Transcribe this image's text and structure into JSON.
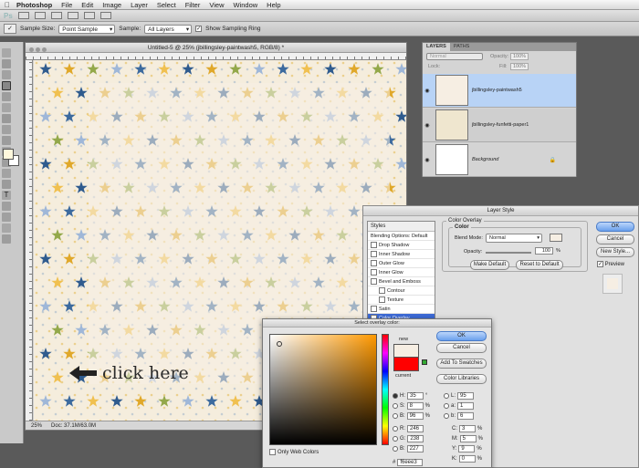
{
  "menubar": {
    "app": "Photoshop",
    "items": [
      "File",
      "Edit",
      "Image",
      "Layer",
      "Select",
      "Filter",
      "View",
      "Window",
      "Help"
    ]
  },
  "appbar": {
    "logo": "Ps"
  },
  "options": {
    "sample_size_label": "Sample Size:",
    "sample_size_value": "Point Sample",
    "sample_label": "Sample:",
    "sample_value": "All Layers",
    "show_ring_label": "Show Sampling Ring"
  },
  "document": {
    "title": "Untitled-5 @ 25% (jbillingsley-paintwash5, RGB/8) *",
    "zoom": "25%",
    "doc_info": "Doc: 37.1M/63.0M"
  },
  "annotation": {
    "text": "click here"
  },
  "layers_panel": {
    "tabs": [
      "LAYERS",
      "PATHS"
    ],
    "blend_value": "Normal",
    "opacity_label": "Opacity:",
    "opacity_value": "100%",
    "lock_label": "Lock:",
    "fill_label": "Fill:",
    "fill_value": "100%",
    "layers": [
      {
        "name": "jbillingsley-paintwash5",
        "selected": true
      },
      {
        "name": "jbillingsley-funfetti-paper1",
        "selected": false
      },
      {
        "name": "Background",
        "selected": false
      }
    ]
  },
  "layer_style": {
    "title": "Layer Style",
    "styles_header": "Styles",
    "blending_options": "Blending Options: Default",
    "items": [
      "Drop Shadow",
      "Inner Shadow",
      "Outer Glow",
      "Inner Glow",
      "Bevel and Emboss",
      "Contour",
      "Texture",
      "Satin",
      "Color Overlay"
    ],
    "section_title": "Color Overlay",
    "sub_title": "Color",
    "blend_mode_label": "Blend Mode:",
    "blend_mode_value": "Normal",
    "opacity_label": "Opacity:",
    "opacity_value": "100",
    "opacity_unit": "%",
    "make_default": "Make Default",
    "reset_default": "Reset to Default",
    "ok": "OK",
    "cancel": "Cancel",
    "new_style": "New Style...",
    "preview": "Preview",
    "overlay_color": "#f6eee3"
  },
  "color_picker": {
    "title": "Select overlay color:",
    "new_label": "new",
    "current_label": "current",
    "ok": "OK",
    "cancel": "Cancel",
    "add_swatches": "Add To Swatches",
    "color_libraries": "Color Libraries",
    "only_web": "Only Web Colors",
    "new_color": "#f6eee3",
    "current_color": "#ff0000",
    "fields": {
      "H": "35",
      "H_unit": "°",
      "S": "8",
      "S_unit": "%",
      "B": "96",
      "B_unit": "%",
      "R": "246",
      "G": "238",
      "Bl": "227",
      "L": "95",
      "a": "1",
      "b": "6",
      "C": "3",
      "M": "5",
      "Y": "9",
      "K": "0",
      "pct": "%",
      "hex": "f6eee3"
    }
  }
}
